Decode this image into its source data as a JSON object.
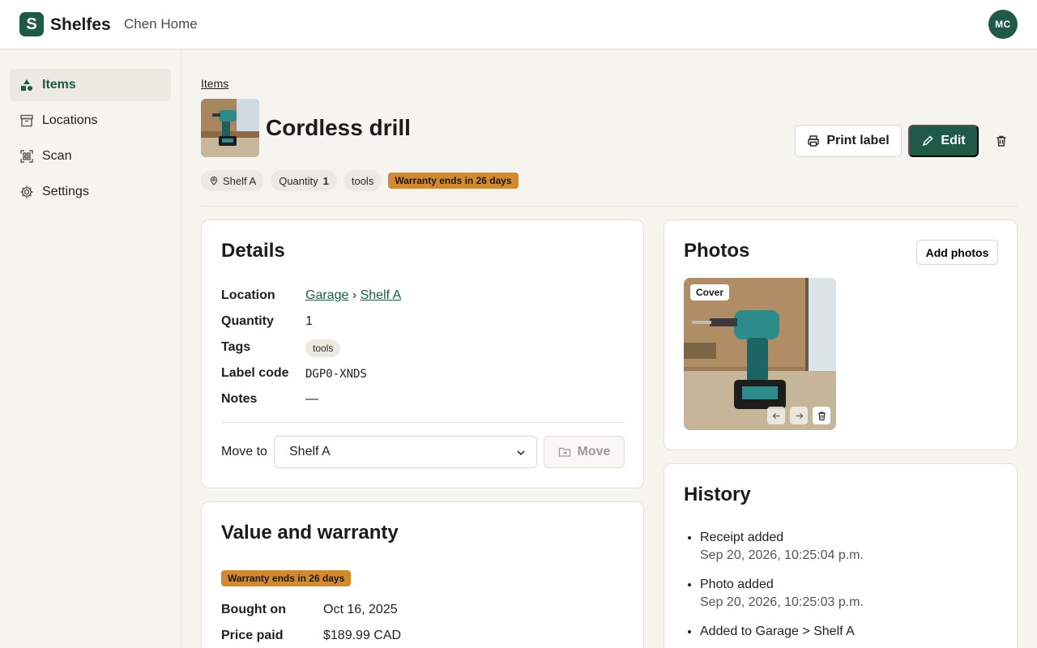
{
  "app": {
    "logo_letter": "S",
    "brand": "Shelfes",
    "household": "Chen Home",
    "avatar_initials": "MC"
  },
  "sidebar": {
    "items": [
      {
        "label": "Items",
        "icon": "shapes-icon",
        "active": true
      },
      {
        "label": "Locations",
        "icon": "archive-box-icon",
        "active": false
      },
      {
        "label": "Scan",
        "icon": "qr-scan-icon",
        "active": false
      },
      {
        "label": "Settings",
        "icon": "gear-icon",
        "active": false
      }
    ]
  },
  "item": {
    "breadcrumb": "Items",
    "title": "Cordless drill",
    "actions": {
      "print": "Print label",
      "edit": "Edit"
    },
    "chips": {
      "location": "Shelf A",
      "quantity_label": "Quantity",
      "quantity": "1",
      "tag": "tools",
      "warranty": "Warranty ends in 26 days"
    }
  },
  "details": {
    "title": "Details",
    "location_label": "Location",
    "location_parent": "Garage",
    "location_sep": "›",
    "location_child": "Shelf A",
    "quantity_label": "Quantity",
    "quantity": "1",
    "tags_label": "Tags",
    "tag": "tools",
    "label_code_label": "Label code",
    "label_code": "DGP0-XNDS",
    "notes_label": "Notes",
    "notes": "—",
    "move_label": "Move to",
    "move_selected": "Shelf A",
    "move_button": "Move"
  },
  "photos": {
    "title": "Photos",
    "add_button": "Add photos",
    "cover_badge": "Cover"
  },
  "history": {
    "title": "History",
    "events": [
      {
        "text": "Receipt added",
        "time": "Sep 20, 2026, 10:25:04 p.m."
      },
      {
        "text": "Photo added",
        "time": "Sep 20, 2026, 10:25:03 p.m."
      },
      {
        "text": "Added to Garage > Shelf A",
        "time": ""
      }
    ]
  },
  "value": {
    "title": "Value and warranty",
    "warranty_badge": "Warranty ends in 26 days",
    "bought_label": "Bought on",
    "bought": "Oct 16, 2025",
    "price_label": "Price paid",
    "price": "$189.99 CAD"
  },
  "colors": {
    "brand": "#1e5a47",
    "warning": "#d28a31",
    "background": "#f5f4ef"
  }
}
